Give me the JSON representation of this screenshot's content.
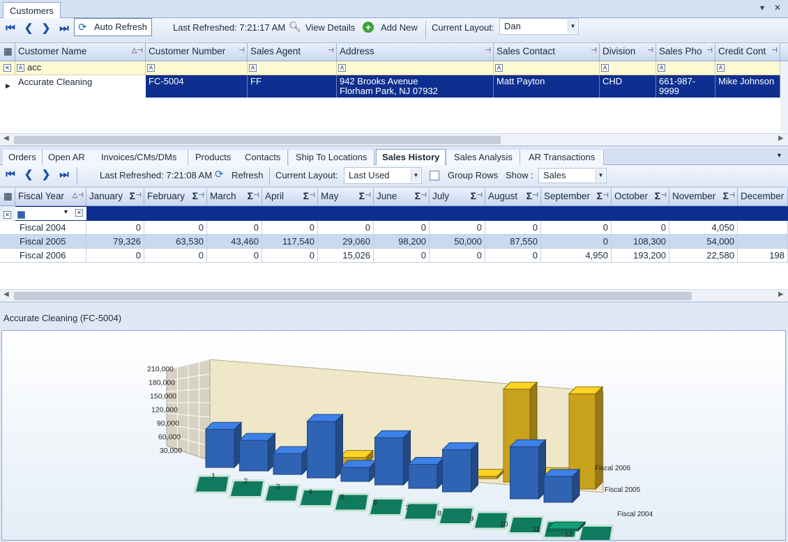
{
  "window": {
    "tab_title": "Customers",
    "pin_glyph": "▾",
    "close_glyph": "✕"
  },
  "main_toolbar": {
    "auto_refresh_label": "Auto Refresh",
    "last_refreshed": "Last Refreshed: 7:21:17 AM",
    "view_details_label": "View Details",
    "add_new_label": "Add New",
    "current_layout_label": "Current Layout:",
    "current_layout_value": "Dan"
  },
  "customers_grid": {
    "columns": [
      "Customer Name",
      "Customer Number",
      "Sales Agent",
      "Address",
      "Sales Contact",
      "Division",
      "Sales Pho",
      "Credit Cont"
    ],
    "filter_text": "acc",
    "row": {
      "customer_name": "Accurate Cleaning",
      "customer_number": "FC-5004",
      "sales_agent": "FF",
      "address_line1": "942 Brooks Avenue",
      "address_line2": "Florham Park, NJ  07932",
      "sales_contact": "Matt Payton",
      "division": "CHD",
      "sales_phone_line1": "661-987-",
      "sales_phone_line2": "9999",
      "credit_contact": "Mike Johnson"
    }
  },
  "detail_tabs": [
    "Orders",
    "Open AR",
    "Invoices/CMs/DMs",
    "Products",
    "Contacts",
    "Ship To Locations",
    "Sales History",
    "Sales Analysis",
    "AR Transactions"
  ],
  "active_tab": "Sales History",
  "history_toolbar": {
    "last_refreshed": "Last Refreshed: 7:21:08 AM",
    "refresh_label": "Refresh",
    "current_layout_label": "Current Layout:",
    "current_layout_value": "Last Used",
    "group_rows_label": "Group Rows",
    "show_label": "Show :",
    "show_value": "Sales"
  },
  "history_grid": {
    "columns": [
      "Fiscal Year",
      "January",
      "February",
      "March",
      "April",
      "May",
      "June",
      "July",
      "August",
      "September",
      "October",
      "November",
      "December"
    ],
    "rows": [
      {
        "year": "Fiscal 2004",
        "values": [
          "0",
          "0",
          "0",
          "0",
          "0",
          "0",
          "0",
          "0",
          "0",
          "0",
          "4,050",
          ""
        ]
      },
      {
        "year": "Fiscal 2005",
        "values": [
          "79,326",
          "63,530",
          "43,460",
          "117,540",
          "29,060",
          "98,200",
          "50,000",
          "87,550",
          "0",
          "108,300",
          "54,000",
          ""
        ]
      },
      {
        "year": "Fiscal 2006",
        "values": [
          "0",
          "0",
          "0",
          "0",
          "15,026",
          "0",
          "0",
          "0",
          "4,950",
          "193,200",
          "22,580",
          "198"
        ]
      }
    ]
  },
  "chart_caption": "Accurate Cleaning  (FC-5004)",
  "chart_data": {
    "type": "bar",
    "title": "",
    "categories": [
      "1",
      "2",
      "3",
      "4",
      "5",
      "6",
      "7",
      "8",
      "9",
      "10",
      "11",
      "12"
    ],
    "series": [
      {
        "name": "Fiscal 2006",
        "values": [
          0,
          0,
          0,
          0,
          15026,
          0,
          0,
          0,
          4950,
          193200,
          22580,
          198000
        ]
      },
      {
        "name": "Fiscal 2005",
        "values": [
          79326,
          63530,
          43460,
          117540,
          29060,
          98200,
          50000,
          87550,
          0,
          108300,
          54000,
          0
        ]
      },
      {
        "name": "Fiscal 2004",
        "values": [
          0,
          0,
          0,
          0,
          0,
          0,
          0,
          0,
          0,
          0,
          4050,
          0
        ]
      }
    ],
    "y_ticks": [
      "30,000",
      "60,000",
      "90,000",
      "120,000",
      "150,000",
      "180,000",
      "210,000"
    ],
    "ylim": [
      0,
      210000
    ],
    "colors": {
      "Fiscal 2006": "#c9a21c",
      "Fiscal 2005": "#2f63b3",
      "Fiscal 2004": "#0f7a5e"
    },
    "grid": true
  }
}
